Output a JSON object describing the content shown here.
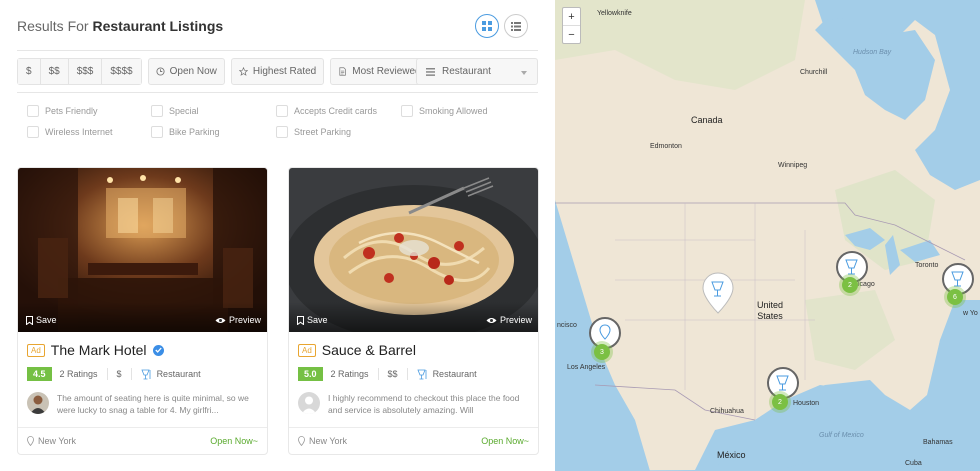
{
  "header": {
    "prefix": "Results For",
    "title": "Restaurant Listings"
  },
  "view_toggle": {
    "grid_icon": "grid-icon",
    "list_icon": "list-icon"
  },
  "filters": {
    "prices": [
      "$",
      "$$",
      "$$$",
      "$$$$"
    ],
    "open_now": "Open Now",
    "highest_rated": "Highest Rated",
    "most_reviewed": "Most Reviewed",
    "category": "Restaurant"
  },
  "amenities": [
    "Pets Friendly",
    "Special",
    "Accepts Credit cards",
    "Smoking Allowed",
    "Wireless Internet",
    "Bike Parking",
    "Street Parking"
  ],
  "cards": [
    {
      "ad": "Ad",
      "title": "The Mark Hotel",
      "verified": true,
      "rating": "4.5",
      "ratings_count": "2 Ratings",
      "price": "$",
      "category": "Restaurant",
      "review": "The amount of seating here is quite minimal, so we were lucky to snag a table for 4. My girlfri...",
      "location": "New York",
      "status": "Open Now~",
      "save": "Save",
      "preview": "Preview"
    },
    {
      "ad": "Ad",
      "title": "Sauce & Barrel",
      "verified": false,
      "rating": "5.0",
      "ratings_count": "2 Ratings",
      "price": "$$",
      "category": "Restaurant",
      "review": "I highly recommend to checkout this place the food and service is absolutely amazing. Will",
      "location": "New York",
      "status": "Open Now~",
      "save": "Save",
      "preview": "Preview"
    }
  ],
  "map": {
    "zoom_in": "+",
    "zoom_out": "−",
    "labels": {
      "yellowknife": "Yellowknife",
      "hudson_bay": "Hudson Bay",
      "churchill": "Churchill",
      "canada": "Canada",
      "edmonton": "Edmonton",
      "winnipeg": "Winnipeg",
      "toronto": "Toronto",
      "chicago": "icago",
      "united_states": "United States",
      "los_angeles": "Los Angeles",
      "francisco": "ncisco",
      "houston": "Houston",
      "chihuahua": "Chihuahua",
      "gulf_of_mexico": "Gulf of Mexico",
      "mexico": "México",
      "bahamas": "Bahamas",
      "cuba": "Cuba",
      "new_york": "w Yo"
    },
    "clusters": [
      "3",
      "2",
      "2",
      "6"
    ]
  },
  "colors": {
    "accent": "#4a9be0",
    "rating": "#75c044",
    "open": "#5aaa2e",
    "ad": "#e8a530"
  }
}
